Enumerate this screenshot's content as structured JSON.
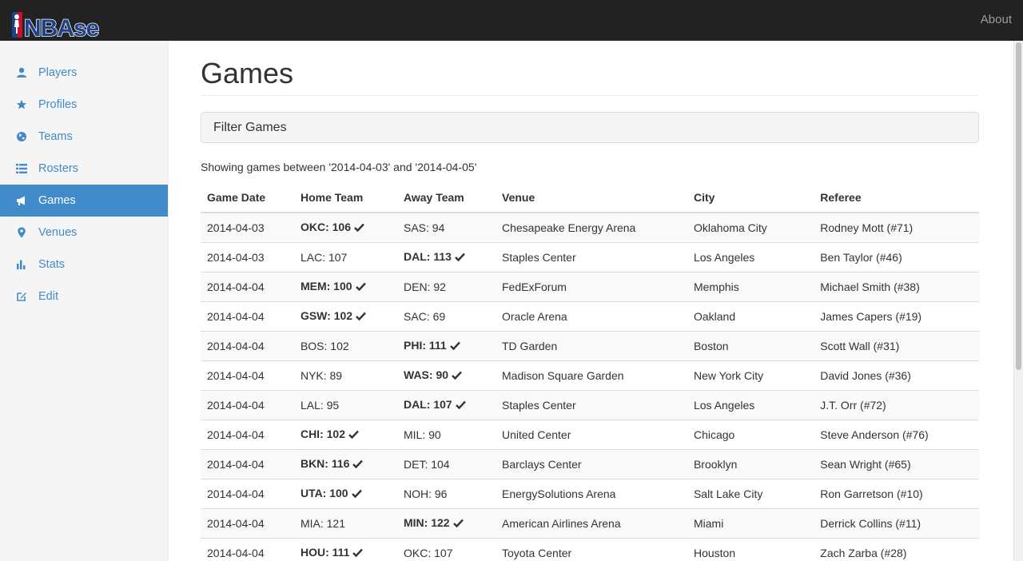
{
  "navbar": {
    "brand": "NBAse",
    "about_label": "About"
  },
  "sidebar": {
    "items": [
      {
        "label": "Players",
        "icon": "user-icon",
        "active": false
      },
      {
        "label": "Profiles",
        "icon": "star-icon",
        "active": false
      },
      {
        "label": "Teams",
        "icon": "globe-icon",
        "active": false
      },
      {
        "label": "Rosters",
        "icon": "list-icon",
        "active": false
      },
      {
        "label": "Games",
        "icon": "bullhorn-icon",
        "active": true
      },
      {
        "label": "Venues",
        "icon": "map-marker-icon",
        "active": false
      },
      {
        "label": "Stats",
        "icon": "stats-icon",
        "active": false
      },
      {
        "label": "Edit",
        "icon": "edit-icon",
        "active": false
      }
    ]
  },
  "main": {
    "title": "Games",
    "filter_label": "Filter Games",
    "showing_text": "Showing games between '2014-04-03' and '2014-04-05'",
    "columns": [
      "Game Date",
      "Home Team",
      "Away Team",
      "Venue",
      "City",
      "Referee"
    ],
    "rows": [
      {
        "date": "2014-04-03",
        "home": "OKC: 106",
        "away": "SAS: 94",
        "winner": "home",
        "venue": "Chesapeake Energy Arena",
        "city": "Oklahoma City",
        "referee": "Rodney Mott (#71)"
      },
      {
        "date": "2014-04-03",
        "home": "LAC: 107",
        "away": "DAL: 113",
        "winner": "away",
        "venue": "Staples Center",
        "city": "Los Angeles",
        "referee": "Ben Taylor (#46)"
      },
      {
        "date": "2014-04-04",
        "home": "MEM: 100",
        "away": "DEN: 92",
        "winner": "home",
        "venue": "FedExForum",
        "city": "Memphis",
        "referee": "Michael Smith (#38)"
      },
      {
        "date": "2014-04-04",
        "home": "GSW: 102",
        "away": "SAC: 69",
        "winner": "home",
        "venue": "Oracle Arena",
        "city": "Oakland",
        "referee": "James Capers (#19)"
      },
      {
        "date": "2014-04-04",
        "home": "BOS: 102",
        "away": "PHI: 111",
        "winner": "away",
        "venue": "TD Garden",
        "city": "Boston",
        "referee": "Scott Wall (#31)"
      },
      {
        "date": "2014-04-04",
        "home": "NYK: 89",
        "away": "WAS: 90",
        "winner": "away",
        "venue": "Madison Square Garden",
        "city": "New York City",
        "referee": "David Jones (#36)"
      },
      {
        "date": "2014-04-04",
        "home": "LAL: 95",
        "away": "DAL: 107",
        "winner": "away",
        "venue": "Staples Center",
        "city": "Los Angeles",
        "referee": "J.T. Orr (#72)"
      },
      {
        "date": "2014-04-04",
        "home": "CHI: 102",
        "away": "MIL: 90",
        "winner": "home",
        "venue": "United Center",
        "city": "Chicago",
        "referee": "Steve Anderson (#76)"
      },
      {
        "date": "2014-04-04",
        "home": "BKN: 116",
        "away": "DET: 104",
        "winner": "home",
        "venue": "Barclays Center",
        "city": "Brooklyn",
        "referee": "Sean Wright (#65)"
      },
      {
        "date": "2014-04-04",
        "home": "UTA: 100",
        "away": "NOH: 96",
        "winner": "home",
        "venue": "EnergySolutions Arena",
        "city": "Salt Lake City",
        "referee": "Ron Garretson (#10)"
      },
      {
        "date": "2014-04-04",
        "home": "MIA: 121",
        "away": "MIN: 122",
        "winner": "away",
        "venue": "American Airlines Arena",
        "city": "Miami",
        "referee": "Derrick Collins (#11)"
      },
      {
        "date": "2014-04-04",
        "home": "HOU: 111",
        "away": "OKC: 107",
        "winner": "home",
        "venue": "Toyota Center",
        "city": "Houston",
        "referee": "Zach Zarba (#28)"
      }
    ]
  }
}
